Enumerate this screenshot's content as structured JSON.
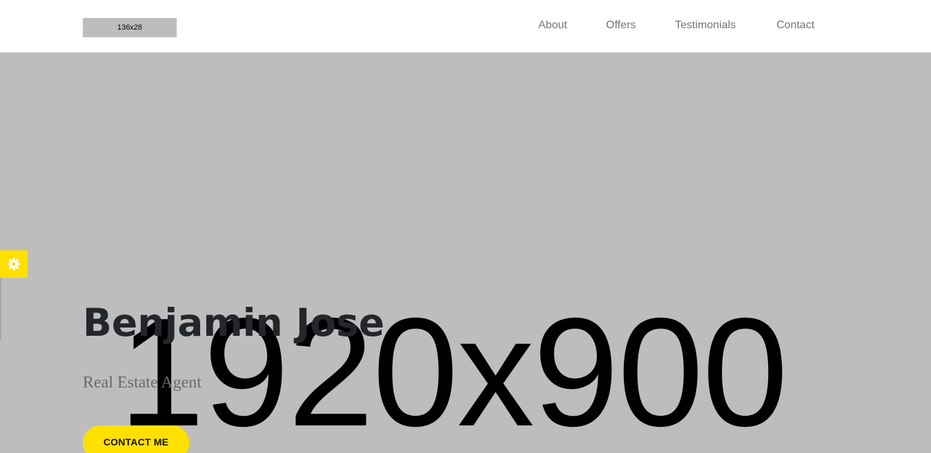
{
  "header": {
    "logo_text": "136x28",
    "nav": {
      "about": "About",
      "offers": "Offers",
      "testimonials": "Testimonials",
      "contact": "Contact"
    }
  },
  "hero": {
    "placeholder_text": "1920x900",
    "title": "Benjamin Jose",
    "subtitle": "Real Estate Agent",
    "cta_label": "CONTACT ME"
  },
  "settings": {
    "icon": "gear-icon"
  },
  "colors": {
    "accent": "#ffe000",
    "hero_bg": "#bdbdbd",
    "nav_text": "#757575",
    "title_text": "#23262b"
  }
}
